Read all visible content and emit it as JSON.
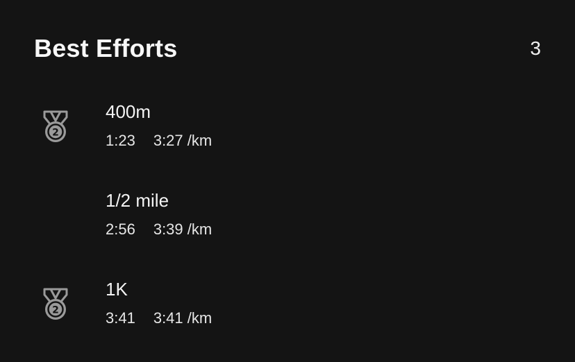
{
  "header": {
    "title": "Best Efforts",
    "count": "3"
  },
  "efforts": [
    {
      "name": "400m",
      "time": "1:23",
      "pace": "3:27 /km",
      "medal_rank": "2",
      "icon": "silver-medal-icon"
    },
    {
      "name": "1/2 mile",
      "time": "2:56",
      "pace": "3:39 /km"
    },
    {
      "name": "1K",
      "time": "3:41",
      "pace": "3:41 /km",
      "medal_rank": "2",
      "icon": "silver-medal-icon"
    }
  ],
  "colors": {
    "background": "#141414",
    "text": "#f2f2f2",
    "medal": "#9a9a9a"
  }
}
